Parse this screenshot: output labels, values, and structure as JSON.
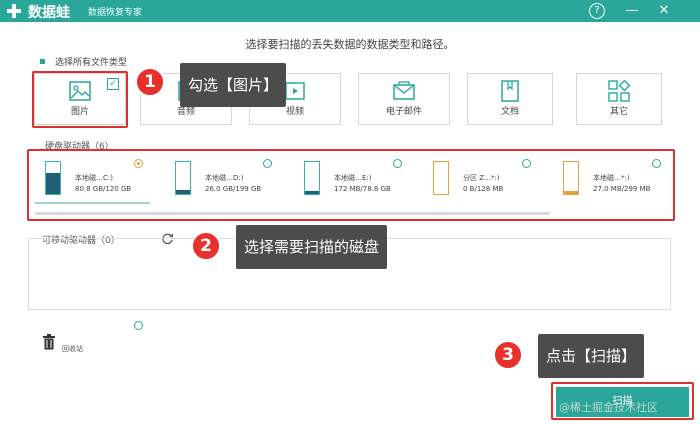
{
  "app": {
    "title": "数据蛙",
    "subtitle": "数据恢复专家"
  },
  "titlebar": {
    "help_icon": "?",
    "minimize_icon": "—",
    "close_icon": "✕"
  },
  "prompt": "选择要扫描的丢失数据的数据类型和路径。",
  "select_all_label": "选择所有文件类型",
  "file_types": [
    {
      "label": "图片",
      "icon": "image-icon",
      "checked": true
    },
    {
      "label": "音频",
      "icon": "audio-icon",
      "checked": false
    },
    {
      "label": "视频",
      "icon": "video-icon",
      "checked": false
    },
    {
      "label": "电子邮件",
      "icon": "email-icon",
      "checked": false
    },
    {
      "label": "文档",
      "icon": "document-icon",
      "checked": false
    },
    {
      "label": "其它",
      "icon": "other-icon",
      "checked": false
    }
  ],
  "callouts": [
    {
      "number": "1",
      "text": "勾选【图片】"
    },
    {
      "number": "2",
      "text": "选择需要扫描的磁盘"
    },
    {
      "number": "3",
      "text": "点击【扫描】"
    }
  ],
  "hard_drives_title": "硬盘驱动器（6）",
  "drives": [
    {
      "name": "本地磁…C:)",
      "size": "80.8 GB/120 GB",
      "fill": 0.67,
      "selected": true,
      "color": "#1f5f77"
    },
    {
      "name": "本地磁…D:)",
      "size": "26.0 GB/199 GB",
      "fill": 0.13,
      "selected": false,
      "color": "#1f5f77"
    },
    {
      "name": "本地磁…E:)",
      "size": "172 MB/78.8 GB",
      "fill": 0.01,
      "selected": false,
      "color": "#1f5f77"
    },
    {
      "name": "分区 Z…*:)",
      "size": "0  B/128 MB",
      "fill": 0.0,
      "selected": false,
      "color": "#e8a13a"
    },
    {
      "name": "本地磁…*:)",
      "size": "27.0 MB/299 MB",
      "fill": 0.09,
      "selected": false,
      "color": "#e8a13a"
    }
  ],
  "removable_title": "可移动驱动器（0）",
  "recycle_bin_label": "回收站",
  "scan_button": "扫描",
  "watermark": "@稀土掘金技术社区",
  "colors": {
    "accent": "#2aa79a",
    "annotation_red": "#e0302d",
    "callout_bg": "#4c4c4c"
  }
}
